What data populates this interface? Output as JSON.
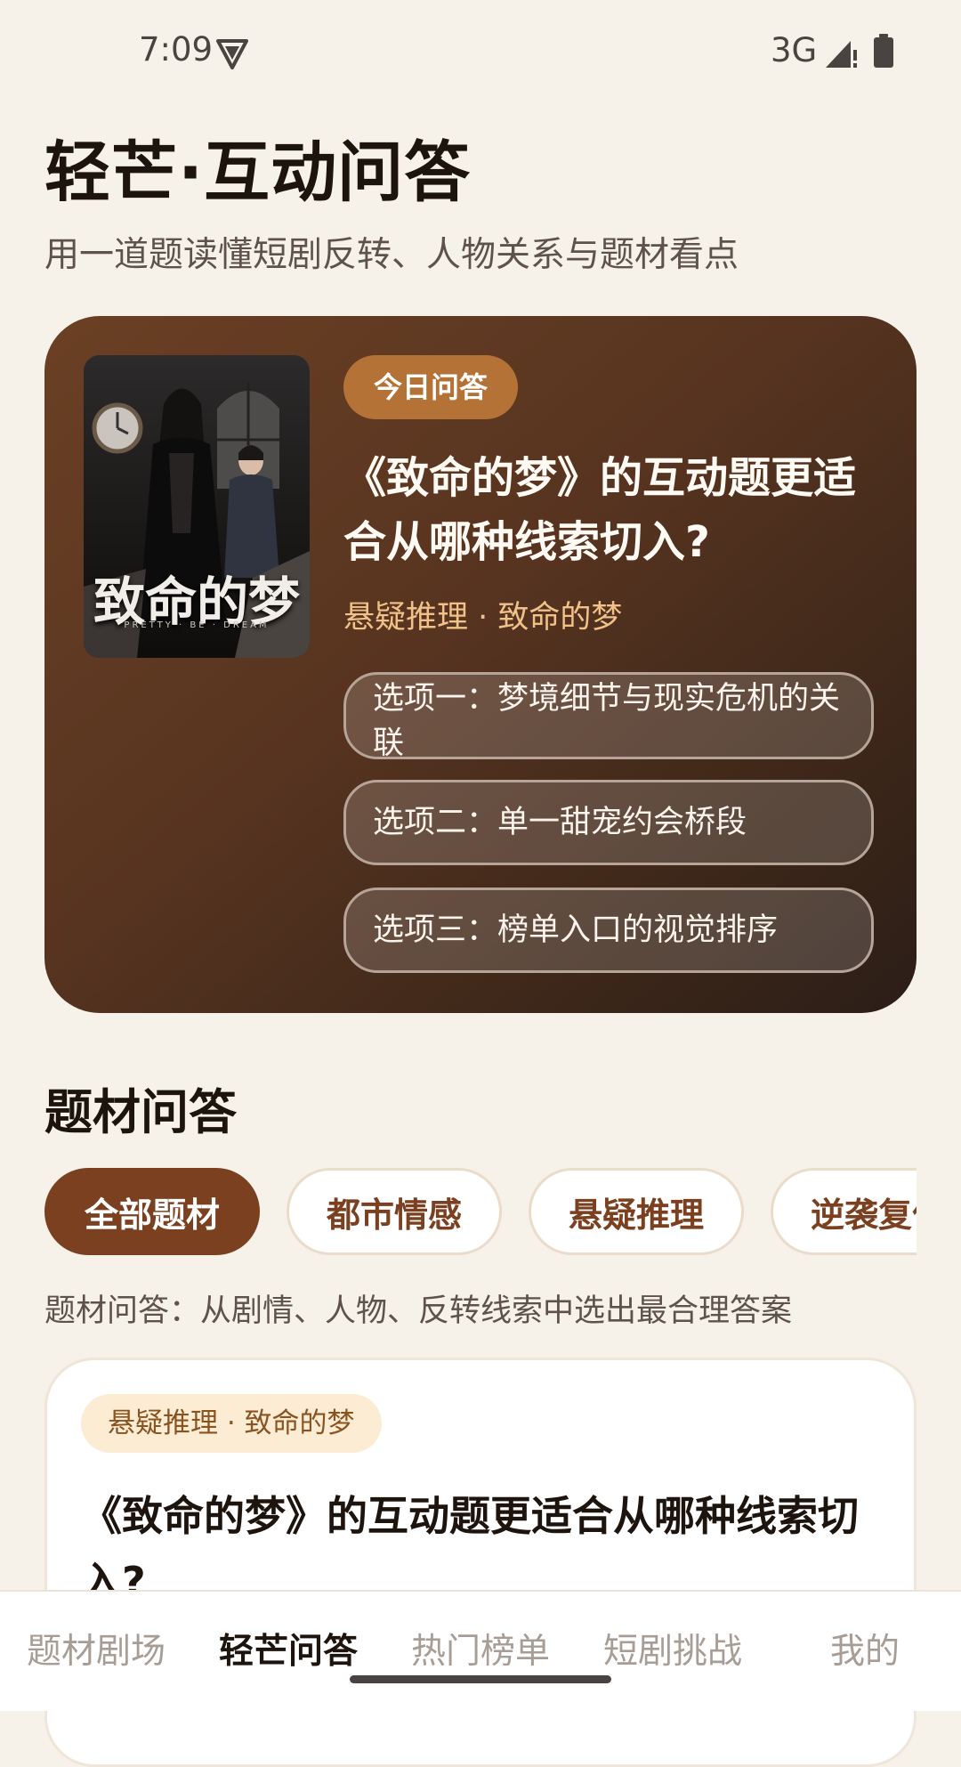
{
  "status_bar": {
    "time": "7:09",
    "network": "3G",
    "icons": [
      "vpn-shield-icon",
      "signal-icon",
      "battery-icon"
    ]
  },
  "header": {
    "title": "轻芒·互动问答",
    "subtitle": "用一道题读懂短剧反转、人物关系与题材看点"
  },
  "featured": {
    "poster_title": "致命的梦",
    "poster_subtitle": "PRETTY · BE · DREAM",
    "badge": "今日问答",
    "question": "《致命的梦》的互动题更适合从哪种线索切入?",
    "meta": "悬疑推理 · 致命的梦",
    "options": [
      "选项一：梦境细节与现实危机的关联",
      "选项二：单一甜宠约会桥段",
      "选项三：榜单入口的视觉排序"
    ]
  },
  "section": {
    "title": "题材问答",
    "chips": [
      "全部题材",
      "都市情感",
      "悬疑推理",
      "逆袭复仇"
    ],
    "selected_chip": "全部题材",
    "hint": "题材问答：从剧情、人物、反转线索中选出最合理答案"
  },
  "question_card": {
    "tag": "悬疑推理 · 致命的梦",
    "question": "《致命的梦》的互动题更适合从哪种线索切入?"
  },
  "bottom_nav": {
    "items": [
      "题材剧场",
      "轻芒问答",
      "热门榜单",
      "短剧挑战",
      "我的"
    ],
    "active": "轻芒问答"
  },
  "colors": {
    "background": "#f6f1e9",
    "accent": "#7a4020",
    "badge": "#b57236",
    "meta_text": "#f0c28a"
  }
}
